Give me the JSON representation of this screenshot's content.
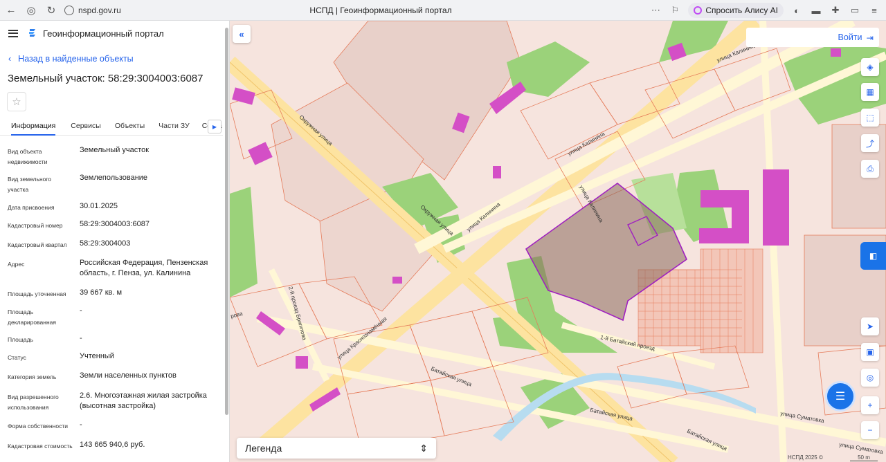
{
  "browser": {
    "url": "nspd.gov.ru",
    "page_title": "НСПД | Геоинформационный портал",
    "alisa_label": "Спросить Алису AI"
  },
  "panel": {
    "portal_name": "Геоинформационный портал",
    "back_label": "Назад в найденные объекты",
    "object_title": "Земельный участок: 58:29:3004003:6087",
    "tabs": [
      "Информация",
      "Сервисы",
      "Объекты",
      "Части ЗУ",
      "Соста"
    ],
    "properties": [
      {
        "label": "Вид объекта недвижимости",
        "value": "Земельный участок"
      },
      {
        "label": "Вид земельного участка",
        "value": "Землепользование"
      },
      {
        "label": "Дата присвоения",
        "value": "30.01.2025"
      },
      {
        "label": "Кадастровый номер",
        "value": "58:29:3004003:6087"
      },
      {
        "label": "Кадастровый квартал",
        "value": "58:29:3004003"
      },
      {
        "label": "Адрес",
        "value": "Российская Федерация, Пензенская область, г. Пенза, ул. Калинина"
      },
      {
        "label": "Площадь уточненная",
        "value": "39 667 кв. м"
      },
      {
        "label": "Площадь декларированная",
        "value": "-"
      },
      {
        "label": "Площадь",
        "value": "-"
      },
      {
        "label": "Статус",
        "value": "Учтенный"
      },
      {
        "label": "Категория земель",
        "value": "Земли населенных пунктов"
      },
      {
        "label": "Вид разрешенного использования",
        "value": "2.6. Многоэтажная жилая застройка (высотная застройка)"
      },
      {
        "label": "Форма собственности",
        "value": "-"
      },
      {
        "label": "Кадастровая стоимость",
        "value": "143 665 940,6 руб."
      }
    ]
  },
  "map": {
    "login_label": "Войти",
    "legend_label": "Легенда",
    "attribution": "НСПД 2025 ©",
    "scale_label": "50 m",
    "street_labels": [
      "Окружная улица",
      "Окружная улица",
      "улица Калинина",
      "улица Калинина",
      "улица Калинина",
      "улица Калинина",
      "2-й проезд Бригитова",
      "улица Краснознамённая",
      "1-й Батайский проезд",
      "Батайская улица",
      "Батайская улица",
      "Батайская улица",
      "улица Суматовка",
      "улица Суматовка",
      "рова"
    ],
    "colors": {
      "base": "#f6e4de",
      "road": "#fff7d6",
      "road_major": "#fde3a0",
      "green": "#9bd27a",
      "selected_parcel": "#8a6a5c",
      "selected_outline": "#a020c0",
      "magenta_building": "#d44fc6",
      "parcel_line": "#e57b5a",
      "water": "#b7dcf0",
      "accent": "#2563eb"
    }
  }
}
